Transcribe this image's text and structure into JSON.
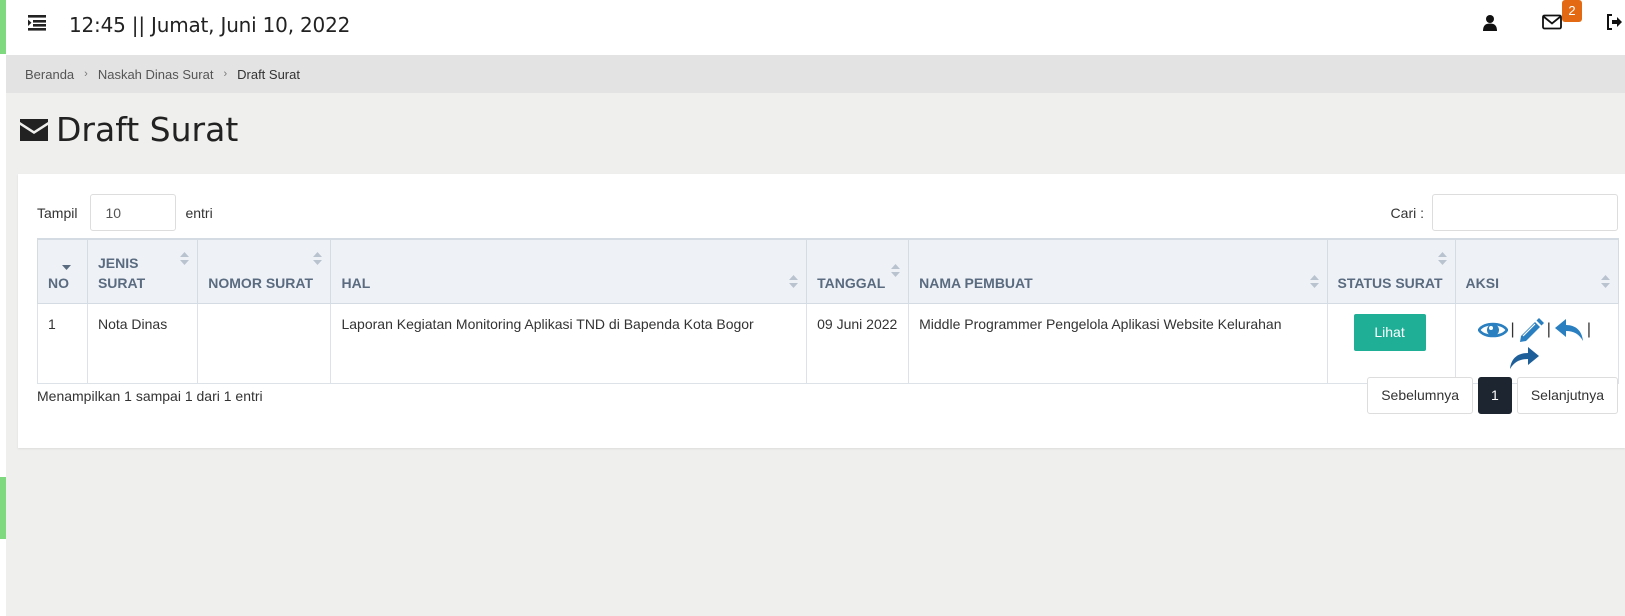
{
  "header": {
    "clock_text": "12:45 || Jumat, Juni 10, 2022",
    "notification_count": "2",
    "badge_color": "#e36a12"
  },
  "breadcrumb": {
    "items": [
      "Beranda",
      "Naskah Dinas Surat",
      "Draft Surat"
    ]
  },
  "page": {
    "title": "Draft Surat",
    "title_icon": "envelope-icon"
  },
  "controls": {
    "show_label": "Tampil",
    "show_value": "10",
    "entries_label": "entri",
    "search_label": "Cari :",
    "search_value": ""
  },
  "table": {
    "columns": [
      "NO",
      "JENIS SURAT",
      "NOMOR SURAT",
      "HAL",
      "TANGGAL",
      "NAMA PEMBUAT",
      "STATUS SURAT",
      "AKSI"
    ],
    "rows": [
      {
        "no": "1",
        "jenis": "Nota Dinas",
        "nomor": "",
        "hal": "Laporan Kegiatan Monitoring Aplikasi TND di Bapenda Kota Bogor",
        "tanggal": "09 Juni 2022",
        "pembuat": "Middle Programmer Pengelola Aplikasi Website Kelurahan",
        "status_button": "Lihat",
        "actions": [
          "eye-icon",
          "pencil-icon",
          "reply-icon",
          "forward-icon"
        ]
      }
    ]
  },
  "footer": {
    "info": "Menampilkan 1 sampai 1 dari 1 entri",
    "prev_label": "Sebelumnya",
    "current_page": "1",
    "next_label": "Selanjutnya"
  },
  "colors": {
    "accent_green": "#1fae96",
    "active_page": "#1c2530",
    "action_blue": "#2a7fc1",
    "forward_blue": "#1f5f99"
  }
}
